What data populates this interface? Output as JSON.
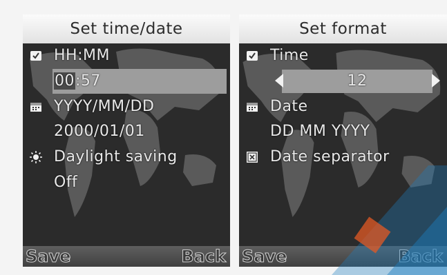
{
  "left": {
    "title": "Set time/date",
    "time_format_label": "HH:MM",
    "time_value_cursor": "00",
    "time_value_rest": ":57",
    "date_format_label": "YYYY/MM/DD",
    "date_value": "2000/01/01",
    "daylight_label": "Daylight saving",
    "daylight_value": "Off",
    "soft_left": "Save",
    "soft_right": "Back"
  },
  "right": {
    "title": "Set format",
    "time_label": "Time",
    "time_value": "12",
    "date_label": "Date",
    "date_value": "DD MM YYYY",
    "separator_label": "Date separator",
    "soft_left": "Save",
    "soft_right": "Back"
  },
  "icons": [
    "clock-icon",
    "calendar-icon",
    "sun-icon",
    "separator-icon"
  ],
  "colors": {
    "selection": "#9d9d9d",
    "screen": "#2b2b2b",
    "header": "#efefef"
  }
}
